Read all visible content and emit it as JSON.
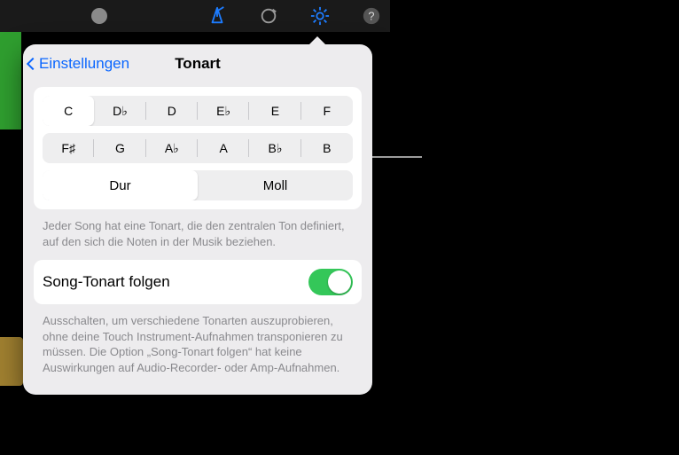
{
  "toolbar": {
    "icons": [
      "metronome-icon",
      "loop-icon",
      "settings-gear-icon",
      "help-icon"
    ]
  },
  "plus_label": "+",
  "popover": {
    "back_label": "Einstellungen",
    "title": "Tonart",
    "keys_row1": [
      "C",
      "D♭",
      "D",
      "E♭",
      "E",
      "F"
    ],
    "keys_row2": [
      "F♯",
      "G",
      "A♭",
      "A",
      "B♭",
      "B"
    ],
    "selected_key_index": 0,
    "modes": [
      "Dur",
      "Moll"
    ],
    "selected_mode_index": 0,
    "key_help": "Jeder Song hat eine Tonart, die den zentralen Ton definiert, auf den sich die Noten in der Musik beziehen.",
    "follow_label": "Song-Tonart folgen",
    "follow_on": true,
    "follow_help": "Ausschalten, um verschiedene Tonarten auszuprobieren, ohne deine Touch Instrument-Aufnahmen transponieren zu müssen. Die Option „Song-Tonart folgen“ hat keine Auswirkungen auf Audio-Recorder- oder Amp-Aufnahmen."
  }
}
